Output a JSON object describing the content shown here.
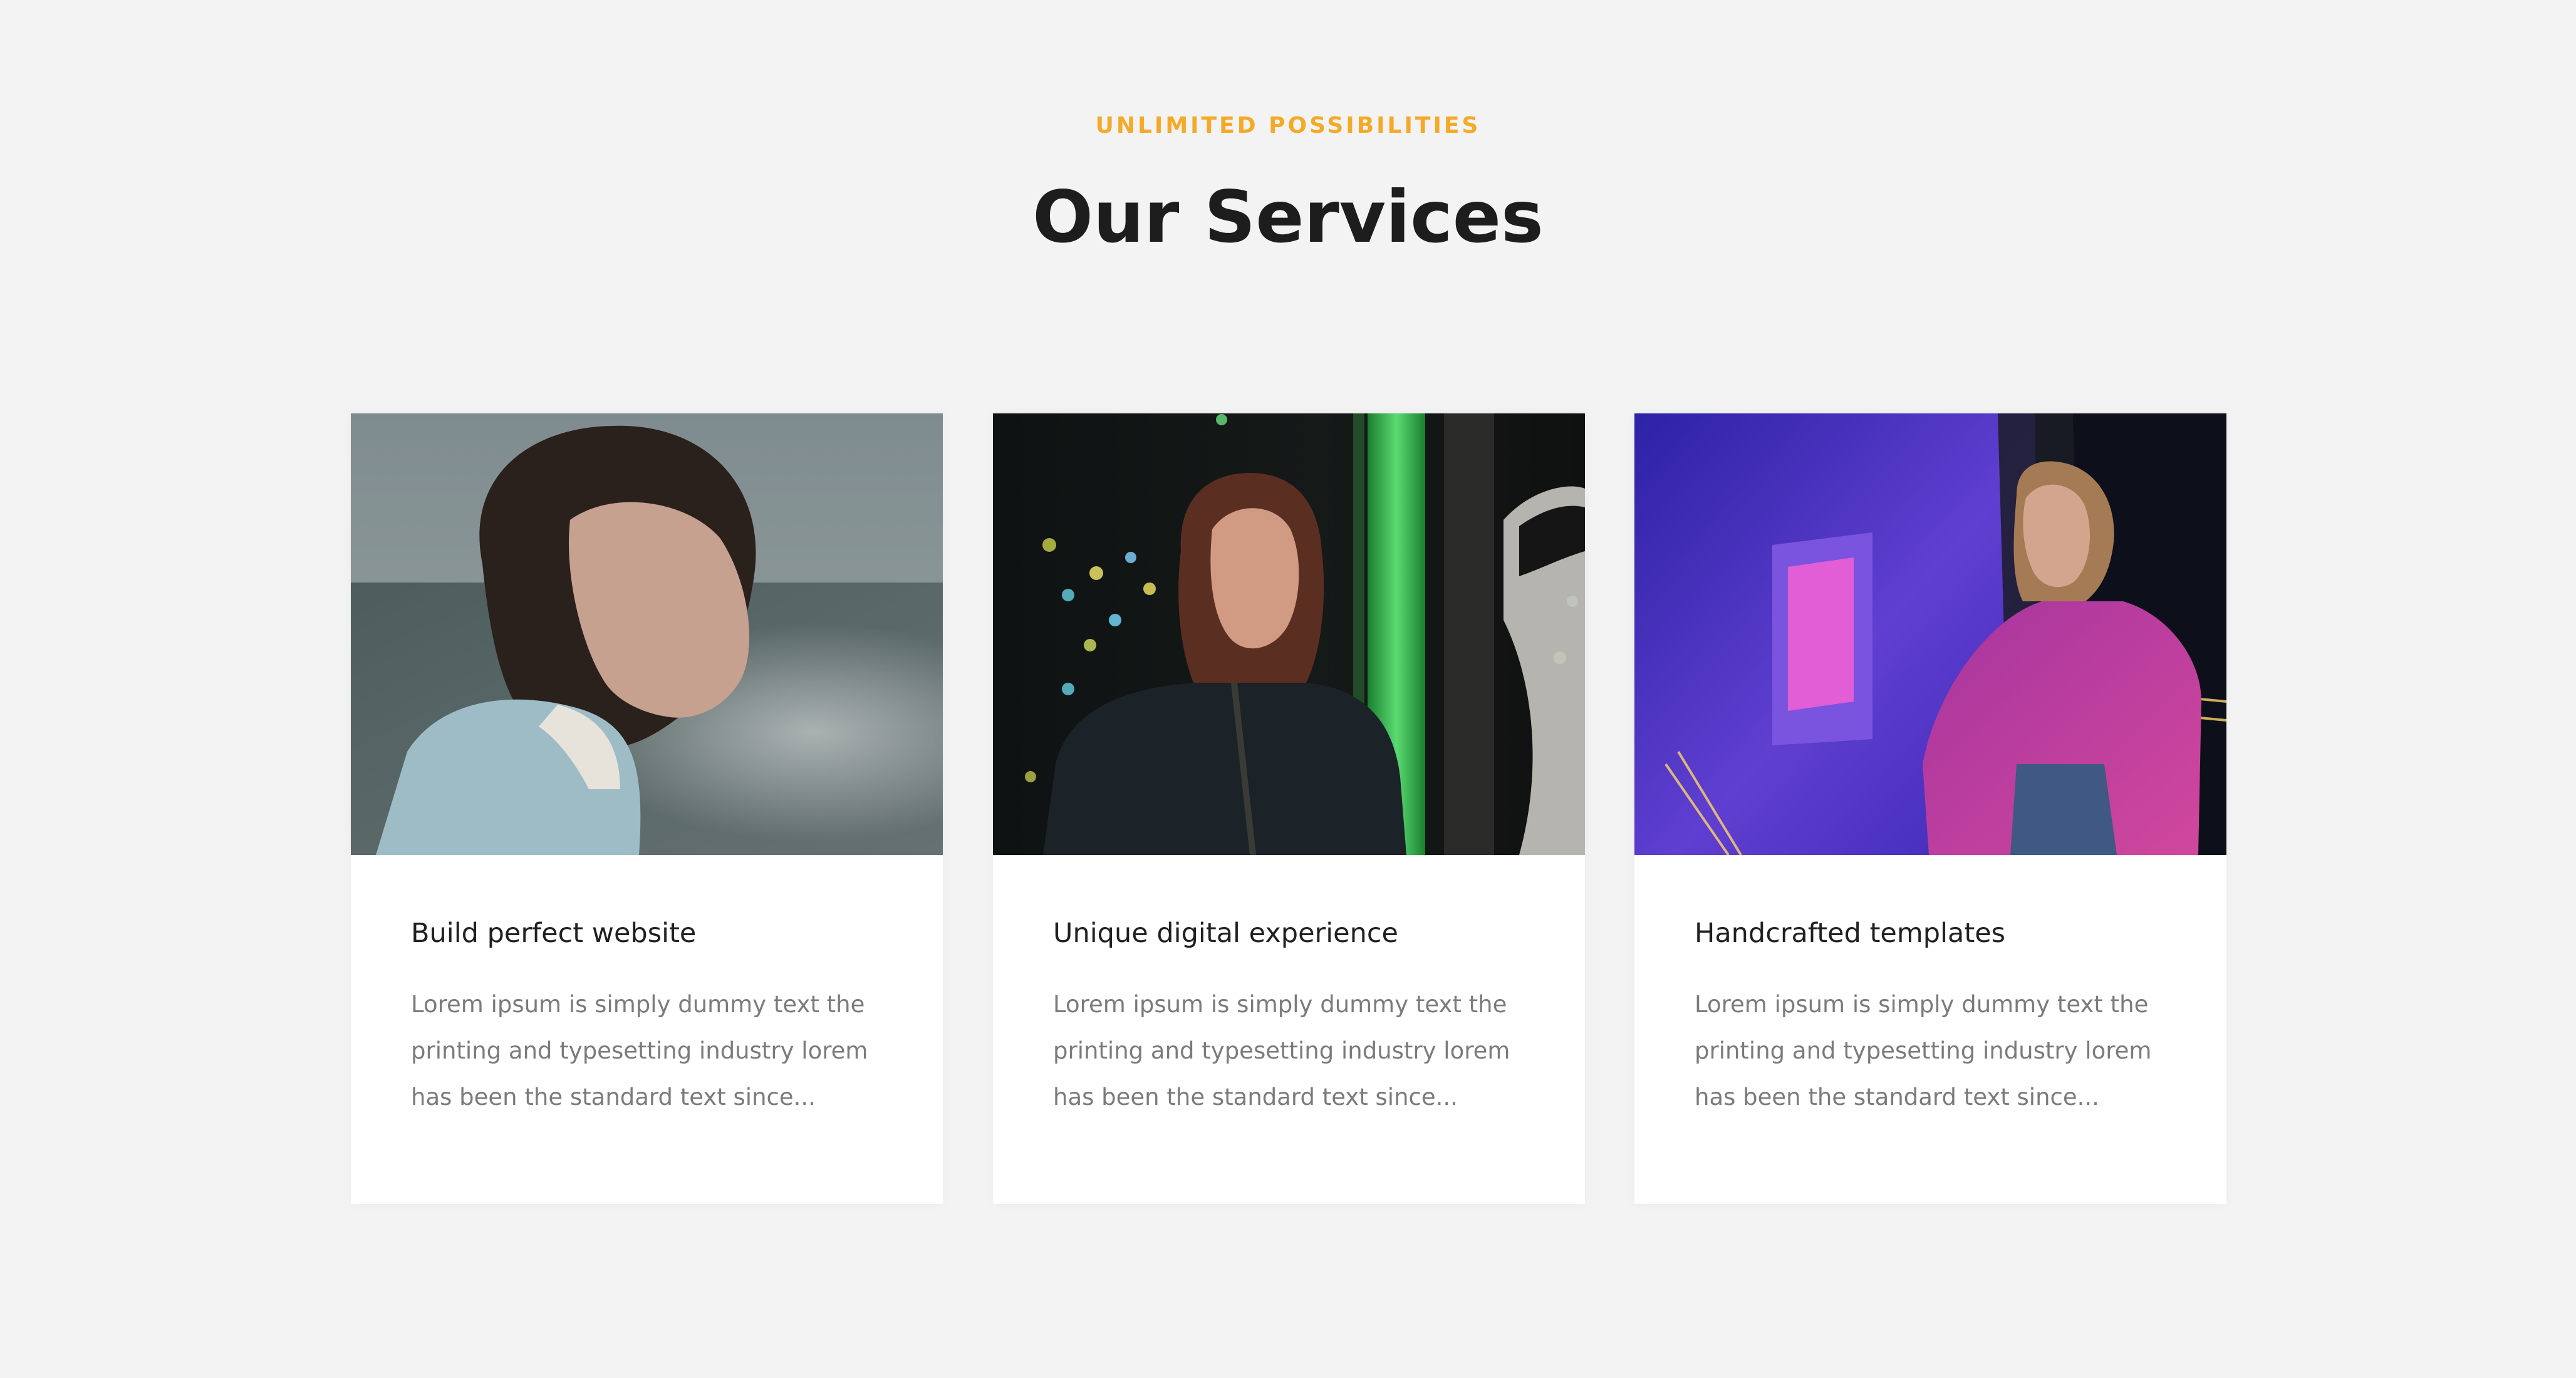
{
  "section": {
    "eyebrow": "UNLIMITED POSSIBILITIES",
    "title": "Our Services"
  },
  "cards": [
    {
      "title": "Build perfect website",
      "text": "Lorem ipsum is simply dummy text the printing and typesetting industry lorem has been the standard text since..."
    },
    {
      "title": "Unique digital experience",
      "text": "Lorem ipsum is simply dummy text the printing and typesetting industry lorem has been the standard text since..."
    },
    {
      "title": "Handcrafted templates",
      "text": "Lorem ipsum is simply dummy text the printing and typesetting industry lorem has been the standard text since..."
    }
  ],
  "colors": {
    "accent": "#f4aa28",
    "background": "#f3f3f3",
    "card": "#ffffff"
  }
}
